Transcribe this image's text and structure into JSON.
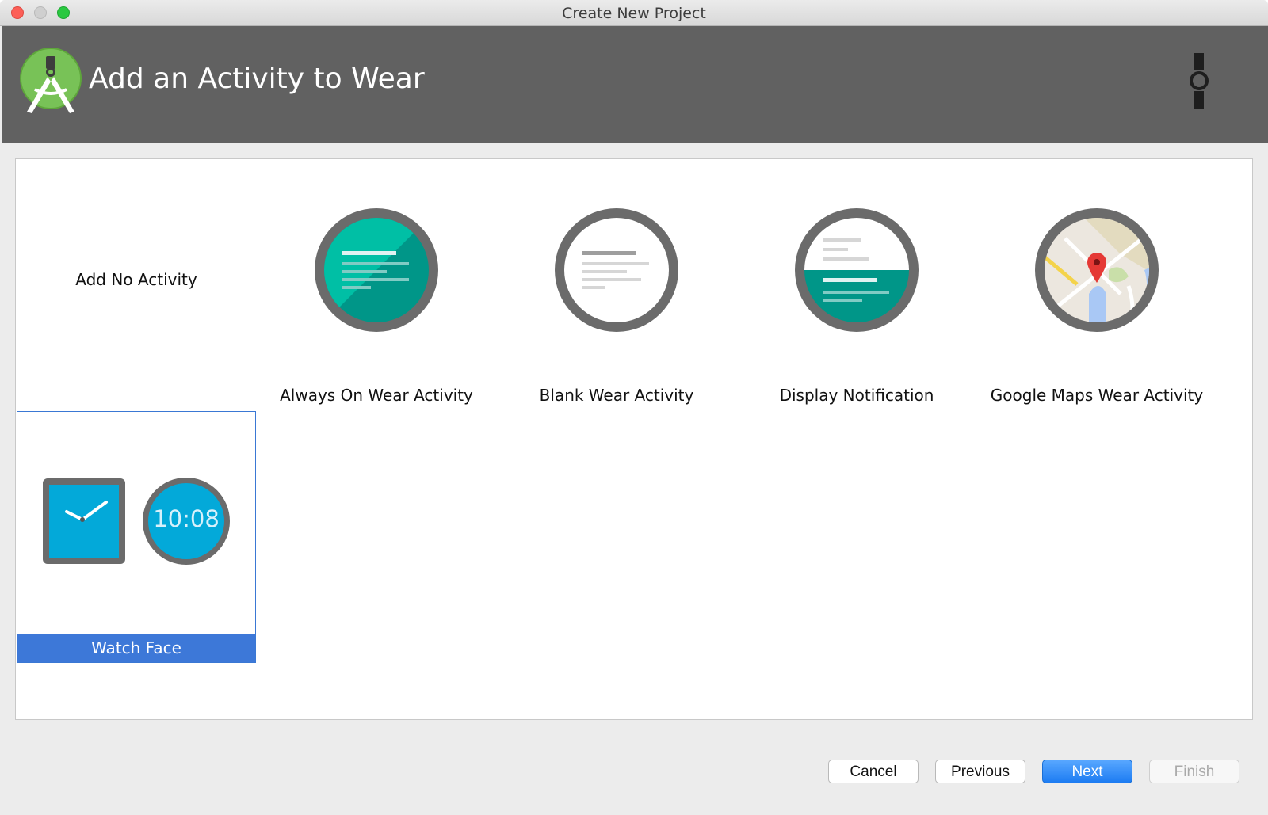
{
  "window": {
    "title": "Create New Project"
  },
  "header": {
    "title": "Add an Activity to Wear",
    "logo_icon": "android-studio-logo",
    "device_icon": "wear-watch-icon"
  },
  "gallery": {
    "items": [
      {
        "label": "Add No Activity",
        "selected": false
      },
      {
        "label": "Always On Wear Activity",
        "selected": false
      },
      {
        "label": "Blank Wear Activity",
        "selected": false
      },
      {
        "label": "Display Notification",
        "selected": false
      },
      {
        "label": "Google Maps Wear Activity",
        "selected": false
      },
      {
        "label": "Watch Face",
        "selected": true,
        "clock_time": "10:08"
      }
    ]
  },
  "footer": {
    "cancel_label": "Cancel",
    "previous_label": "Previous",
    "next_label": "Next",
    "finish_label": "Finish"
  },
  "colors": {
    "header_bg": "#616161",
    "selection": "#3d78d8",
    "teal": "#009688",
    "watch_blue": "#03a9d9"
  }
}
